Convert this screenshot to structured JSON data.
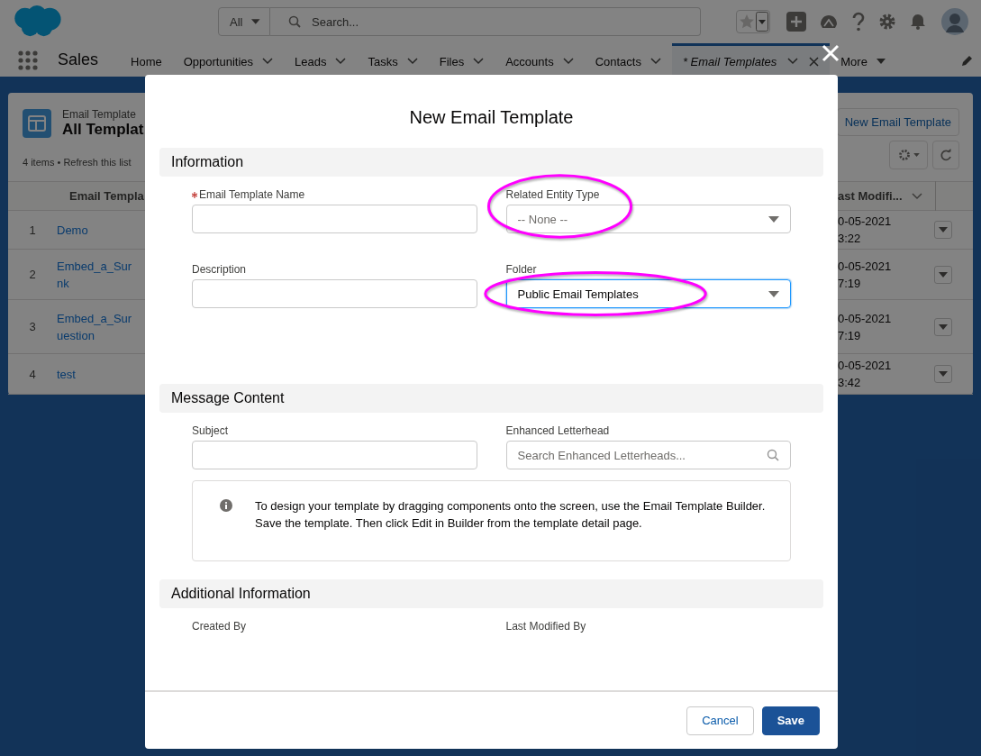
{
  "header": {
    "search_scope": "All",
    "search_placeholder": "Search..."
  },
  "nav": {
    "app_name": "Sales",
    "more": "More",
    "tabs": [
      {
        "label": "Home",
        "dropdown": false,
        "selected": false
      },
      {
        "label": "Opportunities",
        "dropdown": true,
        "selected": false
      },
      {
        "label": "Leads",
        "dropdown": true,
        "selected": false
      },
      {
        "label": "Tasks",
        "dropdown": true,
        "selected": false
      },
      {
        "label": "Files",
        "dropdown": true,
        "selected": false
      },
      {
        "label": "Accounts",
        "dropdown": true,
        "selected": false
      },
      {
        "label": "Contacts",
        "dropdown": true,
        "selected": false
      },
      {
        "label": "* Email Templates",
        "dropdown": true,
        "selected": true
      }
    ]
  },
  "list_view": {
    "object": "Email Template",
    "title": "All Templat",
    "info": "4 items • Refresh this list",
    "new_button": "New Email Template",
    "columns": [
      "Email Templa",
      "ast Modifi..."
    ],
    "rows": [
      {
        "number": "1",
        "name_lines": [
          "Demo"
        ],
        "modified_lines": [
          "0-05-2021",
          "3:22"
        ]
      },
      {
        "number": "2",
        "name_lines": [
          "Embed_a_Sur",
          "nk"
        ],
        "modified_lines": [
          "0-05-2021",
          "7:19"
        ]
      },
      {
        "number": "3",
        "name_lines": [
          "Embed_a_Sur",
          "uestion"
        ],
        "modified_lines": [
          "0-05-2021",
          "7:19"
        ]
      },
      {
        "number": "4",
        "name_lines": [
          "test"
        ],
        "modified_lines": [
          "0-05-2021",
          "3:42"
        ]
      }
    ]
  },
  "modal": {
    "title": "New Email Template",
    "cancel": "Cancel",
    "save": "Save",
    "sections": [
      {
        "title": "Information",
        "fields": [
          {
            "kind": "text",
            "label": "Email Template Name",
            "required": true
          },
          {
            "kind": "picklist",
            "label": "Related Entity Type",
            "value": "-- None --",
            "empty": true,
            "focused": false,
            "highlighted": true
          },
          {
            "kind": "text",
            "label": "Description",
            "required": false
          },
          {
            "kind": "picklist",
            "label": "Folder",
            "value": "Public Email Templates",
            "empty": false,
            "focused": true,
            "highlighted": true
          }
        ]
      },
      {
        "title": "Message Content",
        "fields": [
          {
            "kind": "text",
            "label": "Subject",
            "required": false
          },
          {
            "kind": "search",
            "label": "Enhanced Letterhead",
            "placeholder": "Search Enhanced Letterheads..."
          },
          {
            "kind": "note",
            "paragraphs": [
              "To design your template by dragging components onto the screen, use the Email Template Builder.",
              "Save the template. Then click Edit in Builder from the template detail page."
            ]
          }
        ]
      },
      {
        "title": "Additional Information",
        "fields": [
          {
            "kind": "readonly",
            "label": "Created By"
          },
          {
            "kind": "readonly",
            "label": "Last Modified By"
          }
        ]
      }
    ]
  }
}
